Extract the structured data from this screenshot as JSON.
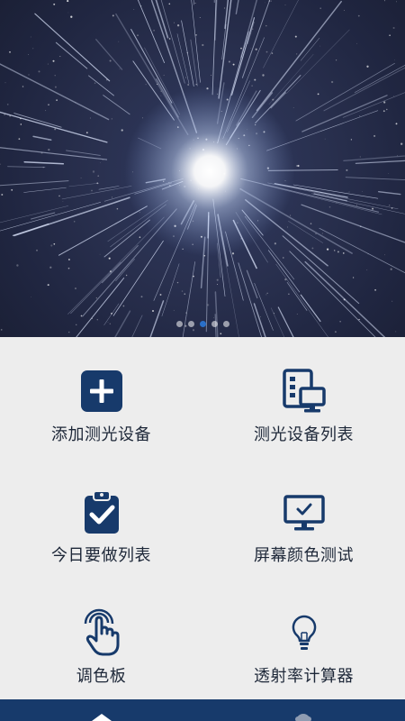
{
  "banner": {
    "slide_count": 5,
    "active_slide": 2
  },
  "menu": [
    {
      "label": "添加测光设备",
      "icon": "plus-square-icon"
    },
    {
      "label": "测光设备列表",
      "icon": "device-list-icon"
    },
    {
      "label": "今日要做列表",
      "icon": "clipboard-check-icon"
    },
    {
      "label": "屏幕颜色测试",
      "icon": "monitor-check-icon"
    },
    {
      "label": "调色板",
      "icon": "touch-hand-icon"
    },
    {
      "label": "透射率计算器",
      "icon": "lightbulb-icon"
    }
  ],
  "colors": {
    "primary": "#173a6b",
    "background": "#ededed",
    "text": "#1d2738",
    "active_dot": "#2a6fc9"
  },
  "tabs": [
    {
      "icon": "home-icon"
    },
    {
      "icon": "profile-icon"
    }
  ]
}
